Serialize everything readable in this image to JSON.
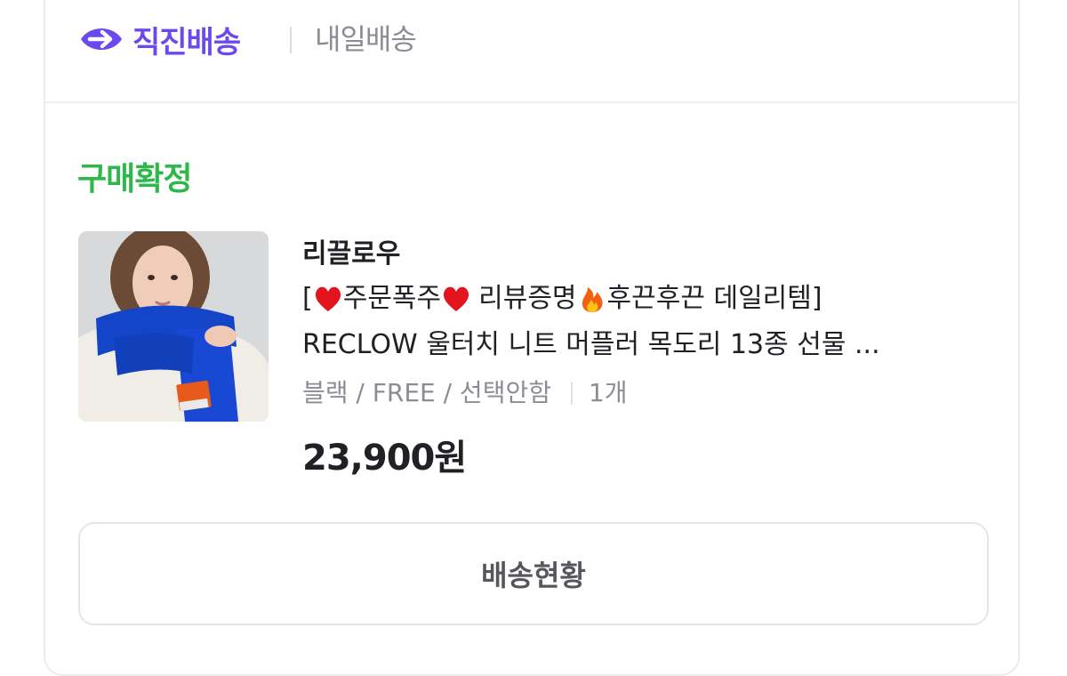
{
  "header": {
    "brand_label": "직진배송",
    "secondary_label": "내일배송",
    "brand_color": "#6a49ee"
  },
  "order": {
    "status": "구매확정",
    "status_color": "#2eb84a",
    "product_image": "blue-knit-scarf-model-photo",
    "seller": "리끌로우",
    "title_line1": {
      "open": "[",
      "part1": "주문폭주",
      "part2": "리뷰증명",
      "part3": "후끈후끈 데일리템]"
    },
    "title_line2": "RECLOW 울터치 니트 머플러 목도리 13종 선물 ...",
    "icons": [
      "heart-icon",
      "heart-icon",
      "fire-icon"
    ],
    "option": "블랙 / FREE / 선택안함",
    "quantity": "1개",
    "price": "23,900원"
  },
  "actions": {
    "track_label": "배송현황"
  }
}
